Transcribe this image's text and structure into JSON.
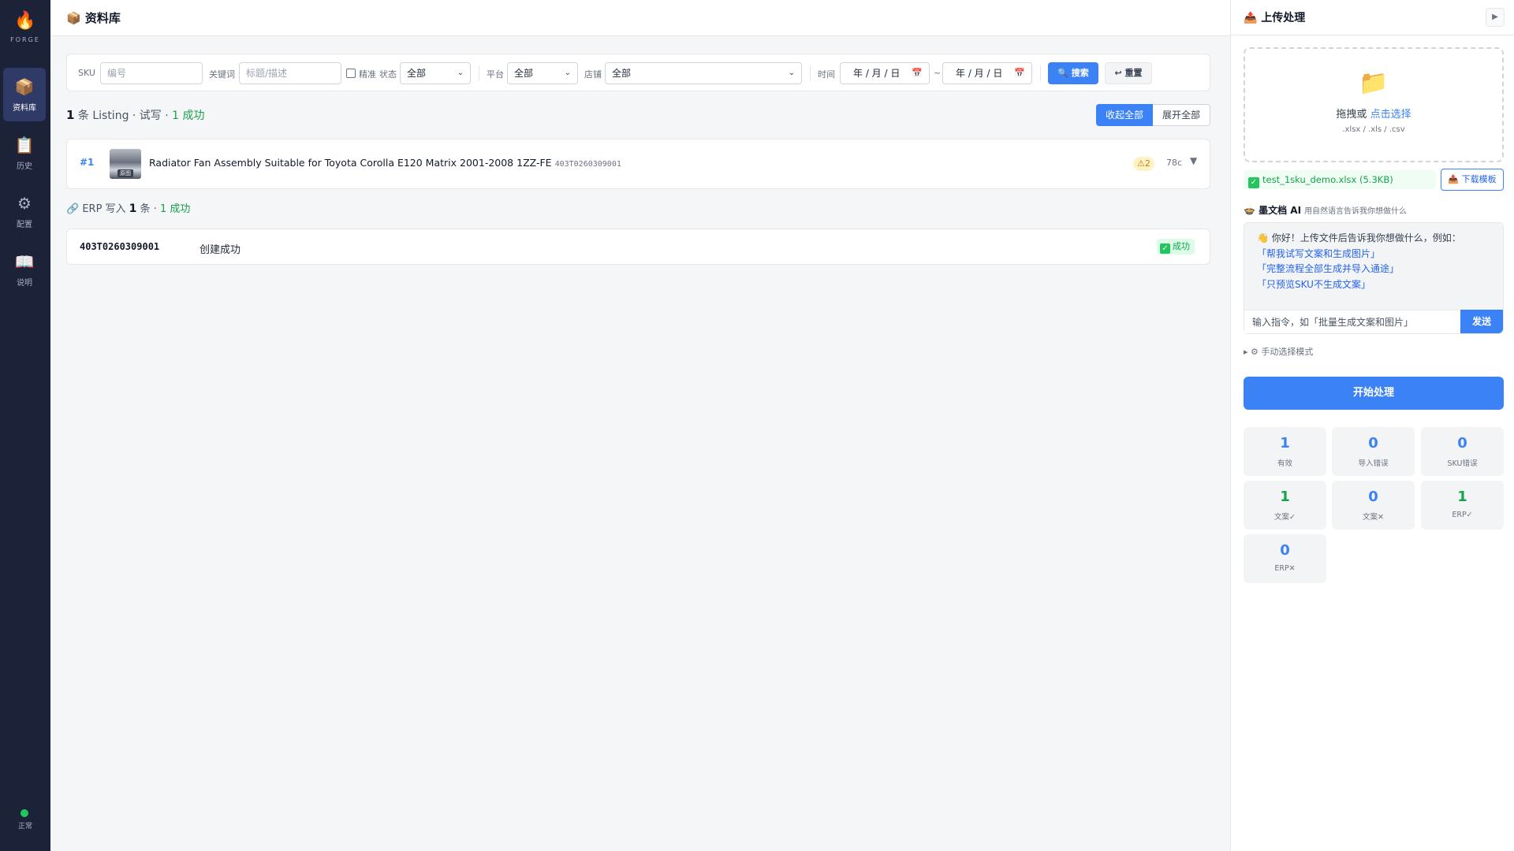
{
  "sidebar": {
    "brand": "FORGE",
    "logo_icon": "🔥",
    "items": [
      {
        "label": "资料库",
        "icon": "📦",
        "active": true
      },
      {
        "label": "历史",
        "icon": "📋",
        "active": false
      },
      {
        "label": "配置",
        "icon": "⚙",
        "active": false
      },
      {
        "label": "说明",
        "icon": "📖",
        "active": false
      }
    ],
    "status": "正常"
  },
  "header": {
    "title": "📦 资料库"
  },
  "filters": {
    "sku_label": "SKU",
    "sku_placeholder": "编号",
    "keyword_label": "关键词",
    "keyword_placeholder": "标题/描述",
    "exact_label": "精准",
    "status_label": "状态",
    "status_value": "全部",
    "platform_label": "平台",
    "platform_value": "全部",
    "shop_label": "店铺",
    "shop_value": "全部",
    "time_label": "时间",
    "date_from": "年 / 月 / 日",
    "date_to": "年 / 月 / 日",
    "range_sep": "~",
    "search_button": "🔍 搜索",
    "reset_button": "↩ 重置"
  },
  "summary": {
    "count": "1",
    "text": " 条 Listing · 试写 · ",
    "success": "1 成功"
  },
  "view_toggle": {
    "collapse_all": "收起全部",
    "expand_all": "展开全部"
  },
  "listing": {
    "index": "#1",
    "title": "Radiator Fan Assembly Suitable for Toyota Corolla E120 Matrix 2001-2008 1ZZ-FE",
    "sku": "403T0260309001",
    "thumb_tag": "原图",
    "warning": "⚠2",
    "chars": "78c",
    "caret": "▼"
  },
  "erp": {
    "prefix": "🔗 ERP 写入 ",
    "count": "1",
    "mid": " 条 · ",
    "success": "1 成功",
    "rows": [
      {
        "sku": "403T0260309001",
        "message": "创建成功",
        "status": "成功"
      }
    ]
  },
  "panel": {
    "title": "📤 上传处理",
    "collapse_icon": "▶",
    "drop_text": "拖拽或 ",
    "drop_link": "点击选择",
    "drop_formats": ".xlsx / .xls / .csv",
    "file_name": "test_1sku_demo.xlsx (5.3KB)",
    "download_template": "📤 下载模板",
    "ai_title": "🍲 墨文档 AI",
    "ai_subtitle": "用自然语言告诉我你想做什么",
    "greeting": "👋 你好！上传文件后告诉我你想做什么，例如：",
    "suggestions": [
      "「帮我试写文案和生成图片」",
      "「完整流程全部生成并导入通途」",
      "「只预览SKU不生成文案」"
    ],
    "input_placeholder": "输入指令，如「批量生成文案和图片」",
    "send": "发送",
    "manual_mode": "▸ ⚙ 手动选择模式",
    "start": "开始处理",
    "stats": [
      {
        "value": "1",
        "label": "有效"
      },
      {
        "value": "0",
        "label": "导入错误"
      },
      {
        "value": "0",
        "label": "SKU错误"
      },
      {
        "value": "1",
        "label": "文案✓"
      },
      {
        "value": "0",
        "label": "文案✕"
      },
      {
        "value": "1",
        "label": "ERP✓"
      },
      {
        "value": "0",
        "label": "ERP✕"
      }
    ]
  },
  "colors": {
    "accent": "#3b82f6",
    "success": "#16a34a",
    "sidebar_bg": "#1c2238"
  }
}
